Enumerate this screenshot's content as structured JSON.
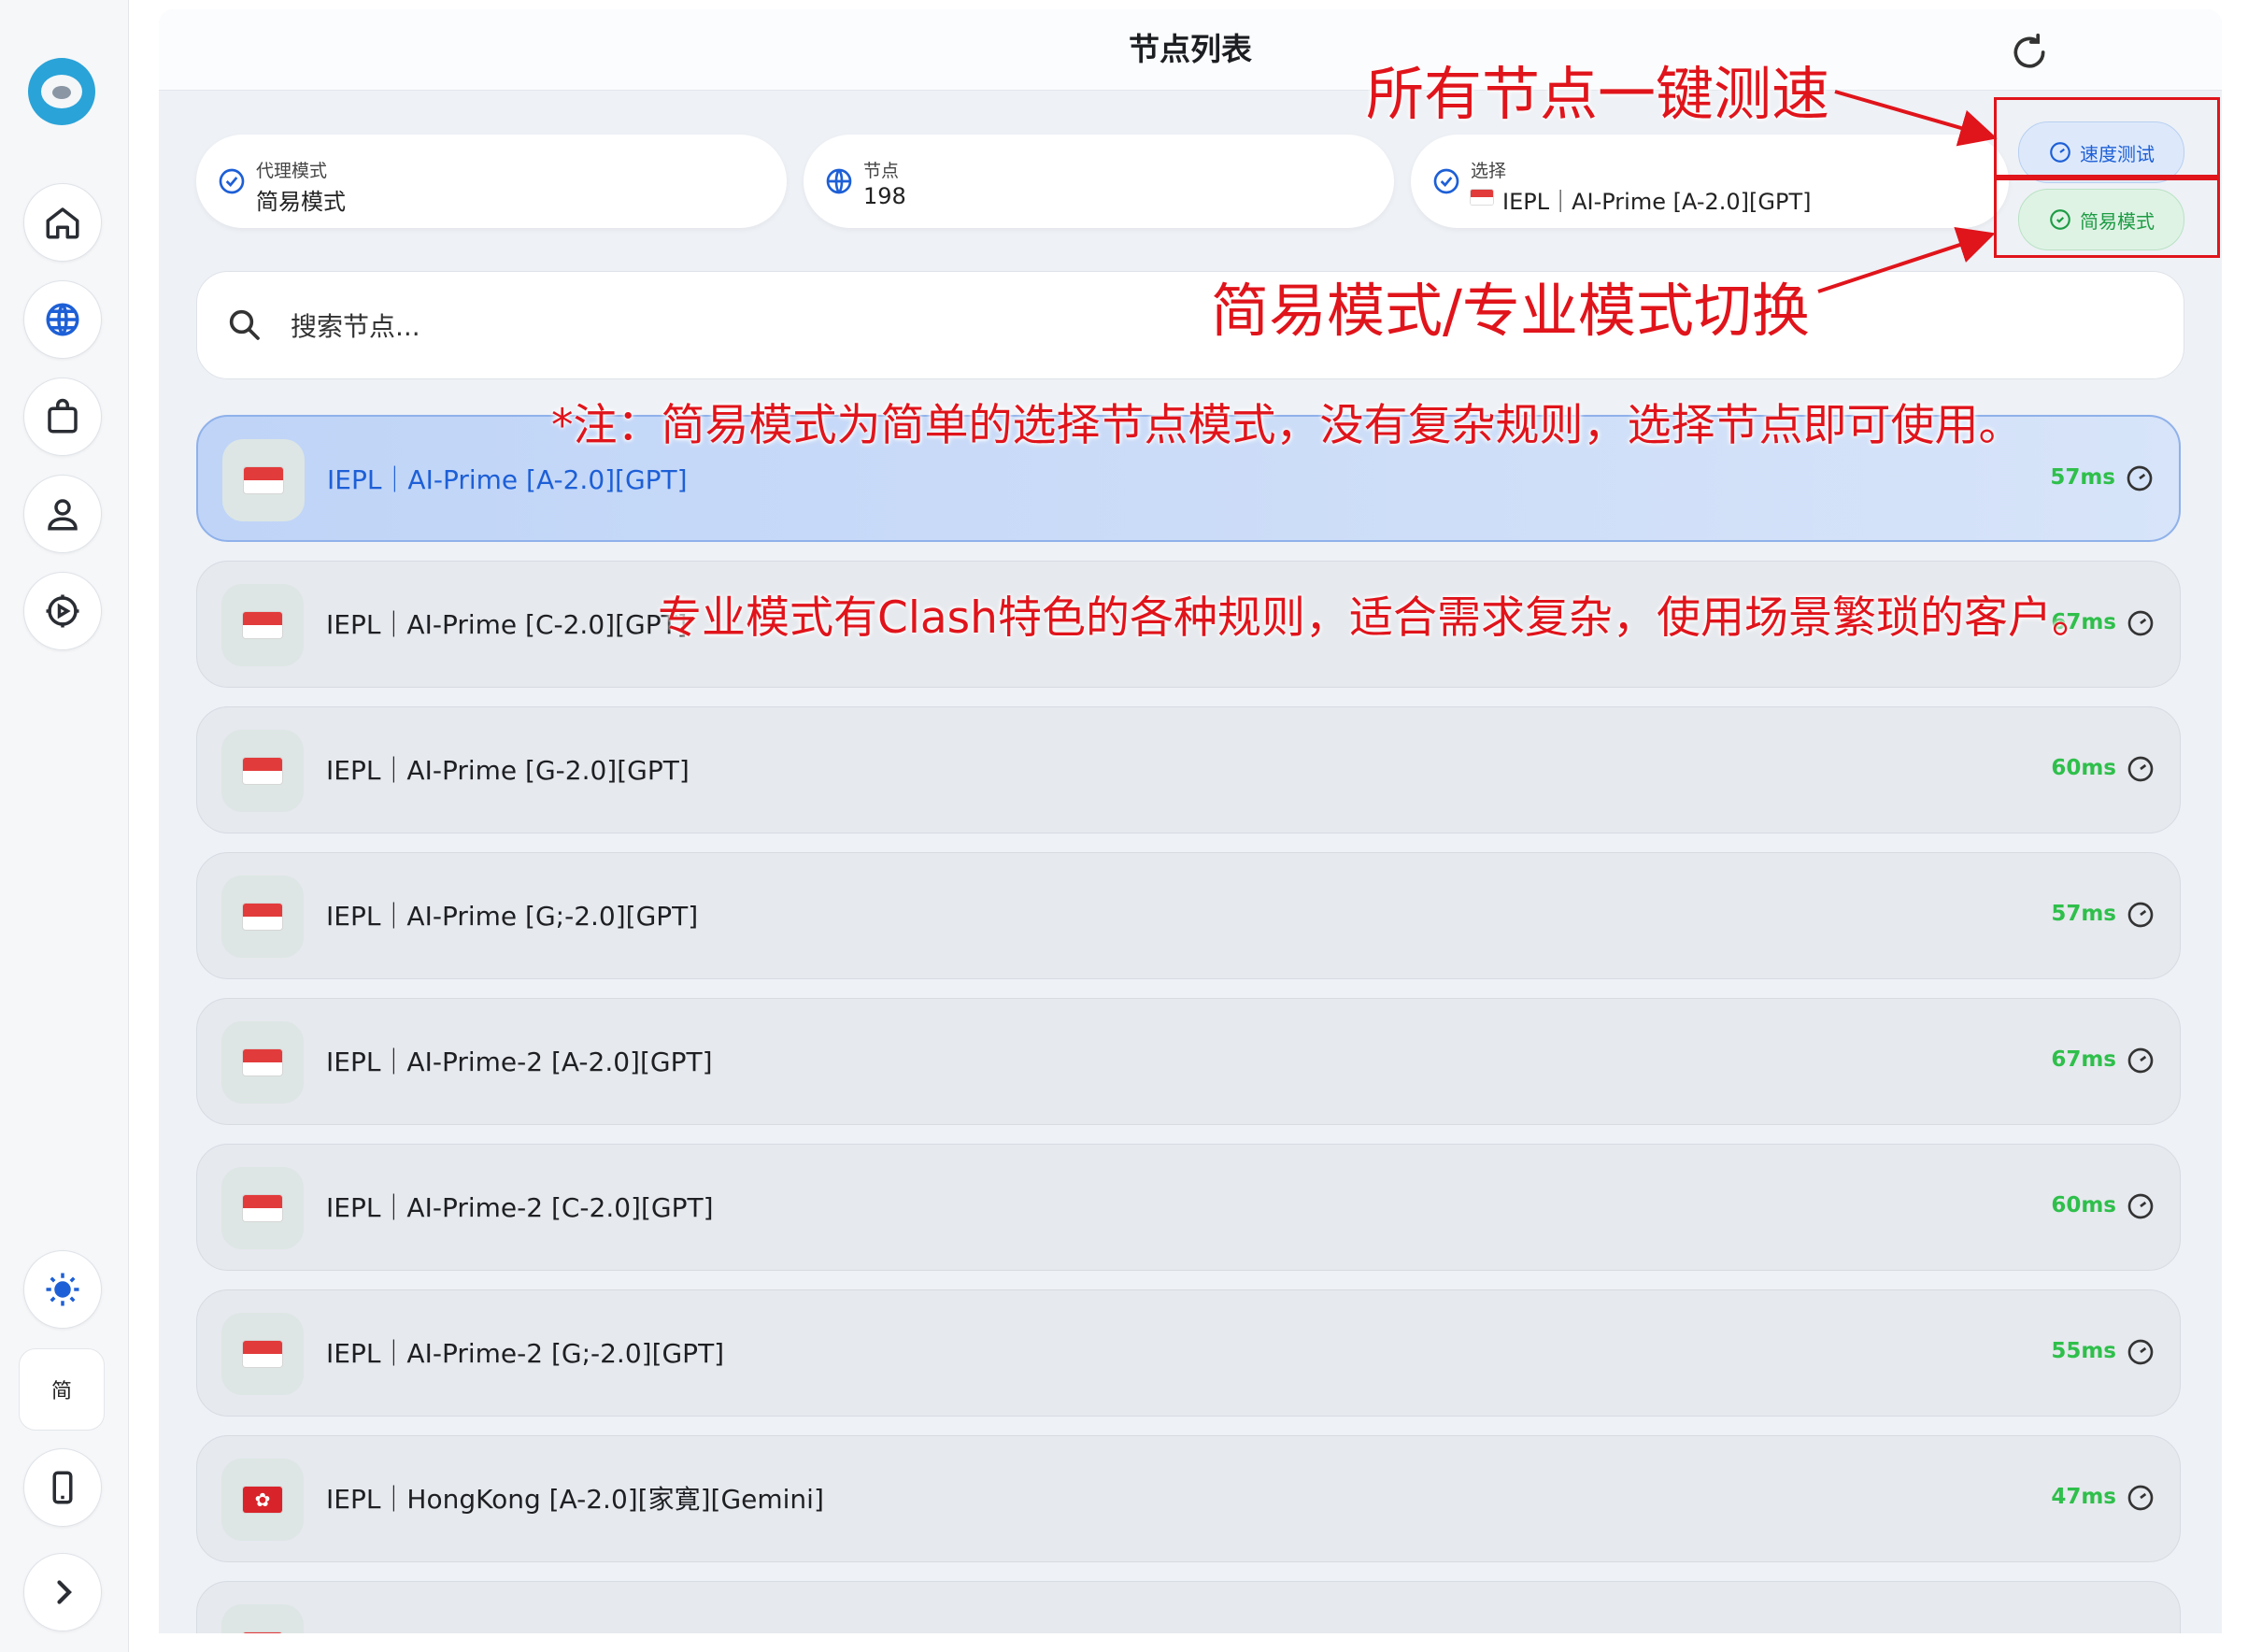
{
  "header": {
    "title": "节点列表"
  },
  "stats": {
    "proxy_mode": {
      "label": "代理模式",
      "value": "简易模式"
    },
    "nodes": {
      "label": "节点",
      "value": "198"
    },
    "selected": {
      "label": "选择",
      "value": "IEPL｜AI-Prime [A-2.0][GPT]"
    }
  },
  "buttons": {
    "speed_test": "速度测试",
    "simple_mode": "简易模式"
  },
  "search": {
    "placeholder": "搜索节点..."
  },
  "nodes": [
    {
      "name": "IEPL｜AI-Prime [A-2.0][GPT]",
      "latency": "57ms",
      "flag": "sg-flag-icon",
      "selected": true
    },
    {
      "name": "IEPL｜AI-Prime [C-2.0][GPT]",
      "latency": "67ms",
      "flag": "sg-flag-icon"
    },
    {
      "name": "IEPL｜AI-Prime [G-2.0][GPT]",
      "latency": "60ms",
      "flag": "sg-flag-icon"
    },
    {
      "name": "IEPL｜AI-Prime [G;-2.0][GPT]",
      "latency": "57ms",
      "flag": "sg-flag-icon"
    },
    {
      "name": "IEPL｜AI-Prime-2 [A-2.0][GPT]",
      "latency": "67ms",
      "flag": "sg-flag-icon"
    },
    {
      "name": "IEPL｜AI-Prime-2 [C-2.0][GPT]",
      "latency": "60ms",
      "flag": "sg-flag-icon"
    },
    {
      "name": "IEPL｜AI-Prime-2 [G;-2.0][GPT]",
      "latency": "55ms",
      "flag": "sg-flag-icon"
    },
    {
      "name": "IEPL｜HongKong [A-2.0][家寛][Gemini]",
      "latency": "47ms",
      "flag": "hk-flag-icon"
    }
  ],
  "sidebar": {
    "items": [
      "home-icon",
      "globe-icon",
      "bag-icon",
      "user-icon",
      "settings-icon"
    ],
    "theme_icon": "sun-icon",
    "language": "简",
    "device_icon": "phone-icon",
    "expand_icon": "chevron-right-icon"
  },
  "annotations": {
    "speed_test_note": "所有节点一键测速",
    "mode_switch_note": "简易模式/专业模式切换",
    "simple_mode_note": "*注：简易模式为简单的选择节点模式，没有复杂规则，选择节点即可使用。",
    "pro_mode_note": "专业模式有Clash特色的各种规则，适合需求复杂，使用场景繁琐的客户。"
  },
  "colors": {
    "accent": "#1d5fd6",
    "latency_good": "#2fbf4b",
    "annotation": "#e0141b",
    "mode_green": "#1e9c44"
  }
}
